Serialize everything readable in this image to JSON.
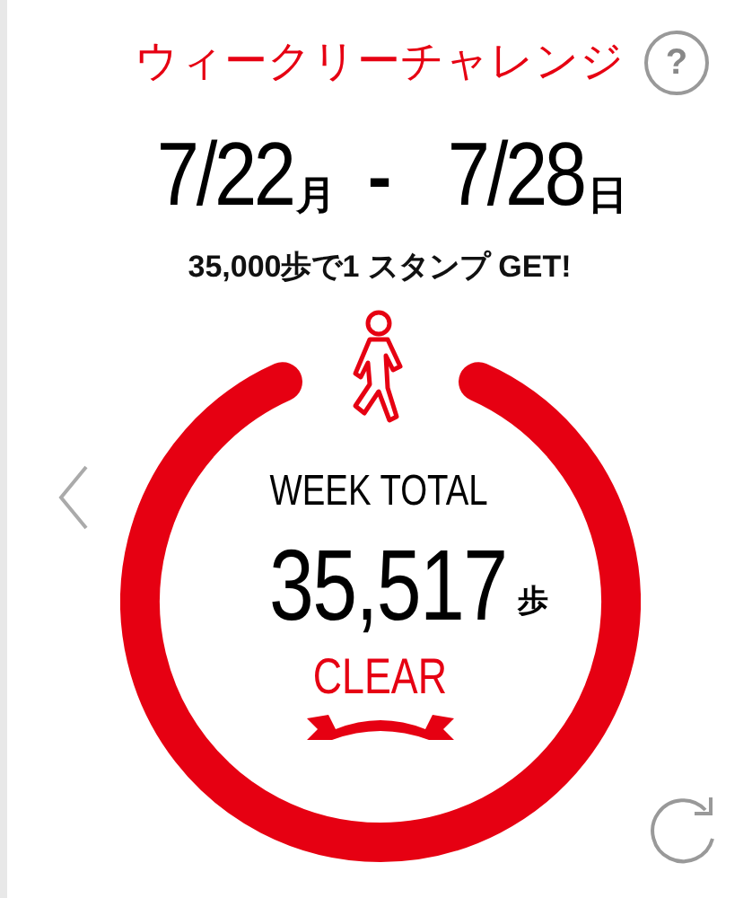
{
  "header": {
    "title": "ウィークリーチャレンジ",
    "help": "?"
  },
  "period": {
    "start": "7/22",
    "start_day": "月",
    "separator": "-",
    "end": "7/28",
    "end_day": "日"
  },
  "goal": "35,000歩で1 スタンプ GET!",
  "total": {
    "label": "WEEK TOTAL",
    "value": "35,517",
    "unit": "歩",
    "status": "CLEAR",
    "cleared": true
  }
}
